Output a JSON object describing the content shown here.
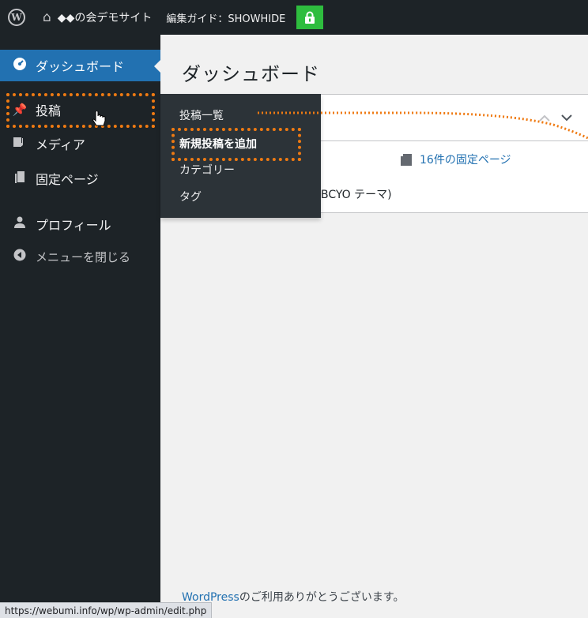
{
  "adminbar": {
    "site_name": "◆◆の会デモサイト",
    "edit_guide": "編集ガイド：SHOWHIDE"
  },
  "sidebar": {
    "items": [
      {
        "label": "ダッシュボード",
        "icon": "dashboard-icon"
      },
      {
        "label": "投稿",
        "icon": "pin-icon"
      },
      {
        "label": "メディア",
        "icon": "media-icon"
      },
      {
        "label": "固定ページ",
        "icon": "page-icon"
      },
      {
        "label": "プロフィール",
        "icon": "user-icon"
      },
      {
        "label": "メニューを閉じる",
        "icon": "collapse-icon"
      }
    ]
  },
  "flyout": {
    "items": [
      {
        "label": "投稿一覧"
      },
      {
        "label": "新規投稿を追加"
      },
      {
        "label": "カテゴリー"
      },
      {
        "label": "タグ"
      }
    ]
  },
  "main": {
    "title": "ダッシュボード",
    "pages_count": "16件の固定ページ",
    "theme_fragment": "BCYO テーマ)"
  },
  "footer": {
    "link_text": "WordPress",
    "thanks": "のご利用ありがとうございます。"
  },
  "statusbar": {
    "url": "https://webumi.info/wp/wp-admin/edit.php"
  },
  "colors": {
    "adminbar_bg": "#1d2327",
    "current_blue": "#2271b1",
    "lock_green": "#2ebd3e",
    "annotation_orange": "#ef7a12"
  }
}
